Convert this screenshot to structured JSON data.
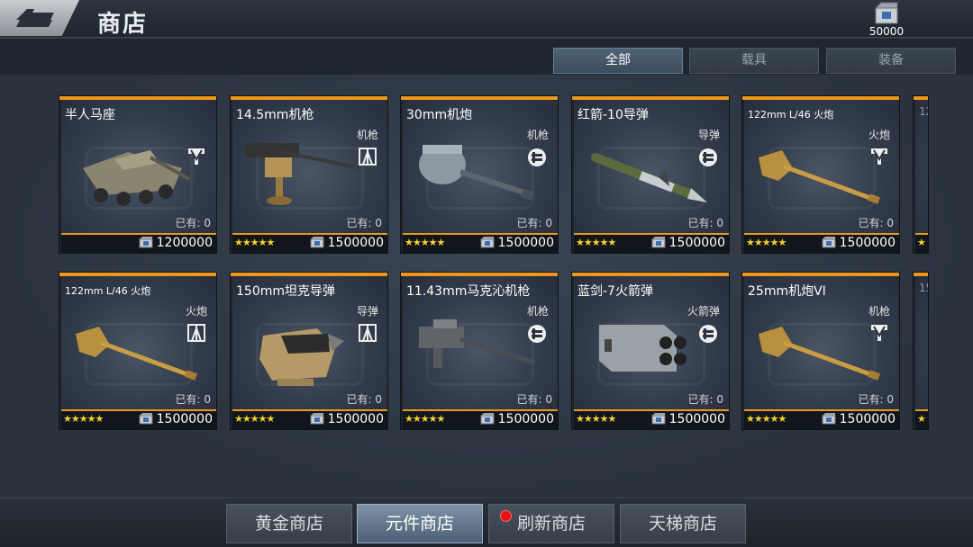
{
  "header": {
    "title": "商店",
    "currency_amount": "50000"
  },
  "filter_tabs": [
    {
      "label": "全部",
      "active": true
    },
    {
      "label": "载具",
      "active": false
    },
    {
      "label": "装备",
      "active": false
    }
  ],
  "owned_label": "已有: 0",
  "items": [
    {
      "name": "半人马座",
      "type": "",
      "icon": "vehicle-icon",
      "weapon": "armored-vehicle",
      "price": "1200000",
      "stars": ""
    },
    {
      "name": "14.5mm机枪",
      "type": "机枪",
      "icon": "rank-icon",
      "weapon": "heavy-machine-gun",
      "price": "1500000",
      "stars": "★★★★★"
    },
    {
      "name": "30mm机炮",
      "type": "机枪",
      "icon": "machinegun-icon",
      "weapon": "autocannon-turret",
      "price": "1500000",
      "stars": "★★★★★"
    },
    {
      "name": "红箭-10导弹",
      "type": "导弹",
      "icon": "machinegun-icon",
      "weapon": "missile",
      "price": "1500000",
      "stars": "★★★★★"
    },
    {
      "name": "122mm L/46 火炮",
      "type": "火炮",
      "icon": "vehicle-icon",
      "weapon": "cannon",
      "price": "1500000",
      "stars": "★★★★★"
    },
    {
      "name": "122mm L/46 火炮",
      "type": "火炮",
      "icon": "rank-icon",
      "weapon": "cannon",
      "price": "1500000",
      "stars": "★★★★★"
    },
    {
      "name": "150mm坦克导弹",
      "type": "导弹",
      "icon": "rank-icon",
      "weapon": "missile-turret",
      "price": "1500000",
      "stars": "★★★★★"
    },
    {
      "name": "11.43mm马克沁机枪",
      "type": "机枪",
      "icon": "machinegun-icon",
      "weapon": "maxim-gun",
      "price": "1500000",
      "stars": "★★★★★"
    },
    {
      "name": "蓝剑-7火箭弹",
      "type": "火箭弹",
      "icon": "machinegun-icon",
      "weapon": "rocket-pod",
      "price": "1500000",
      "stars": "★★★★★"
    },
    {
      "name": "25mm机炮VI",
      "type": "机枪",
      "icon": "vehicle-icon",
      "weapon": "cannon",
      "price": "1500000",
      "stars": "★★★★★"
    }
  ],
  "partial_items": [
    {
      "name": "12",
      "stars": "★"
    },
    {
      "name": "15",
      "stars": "★"
    }
  ],
  "shop_tabs": [
    {
      "label": "黄金商店",
      "active": false
    },
    {
      "label": "元件商店",
      "active": true
    },
    {
      "label": "刷新商店",
      "active": false,
      "notification": true
    },
    {
      "label": "天梯商店",
      "active": false
    }
  ]
}
